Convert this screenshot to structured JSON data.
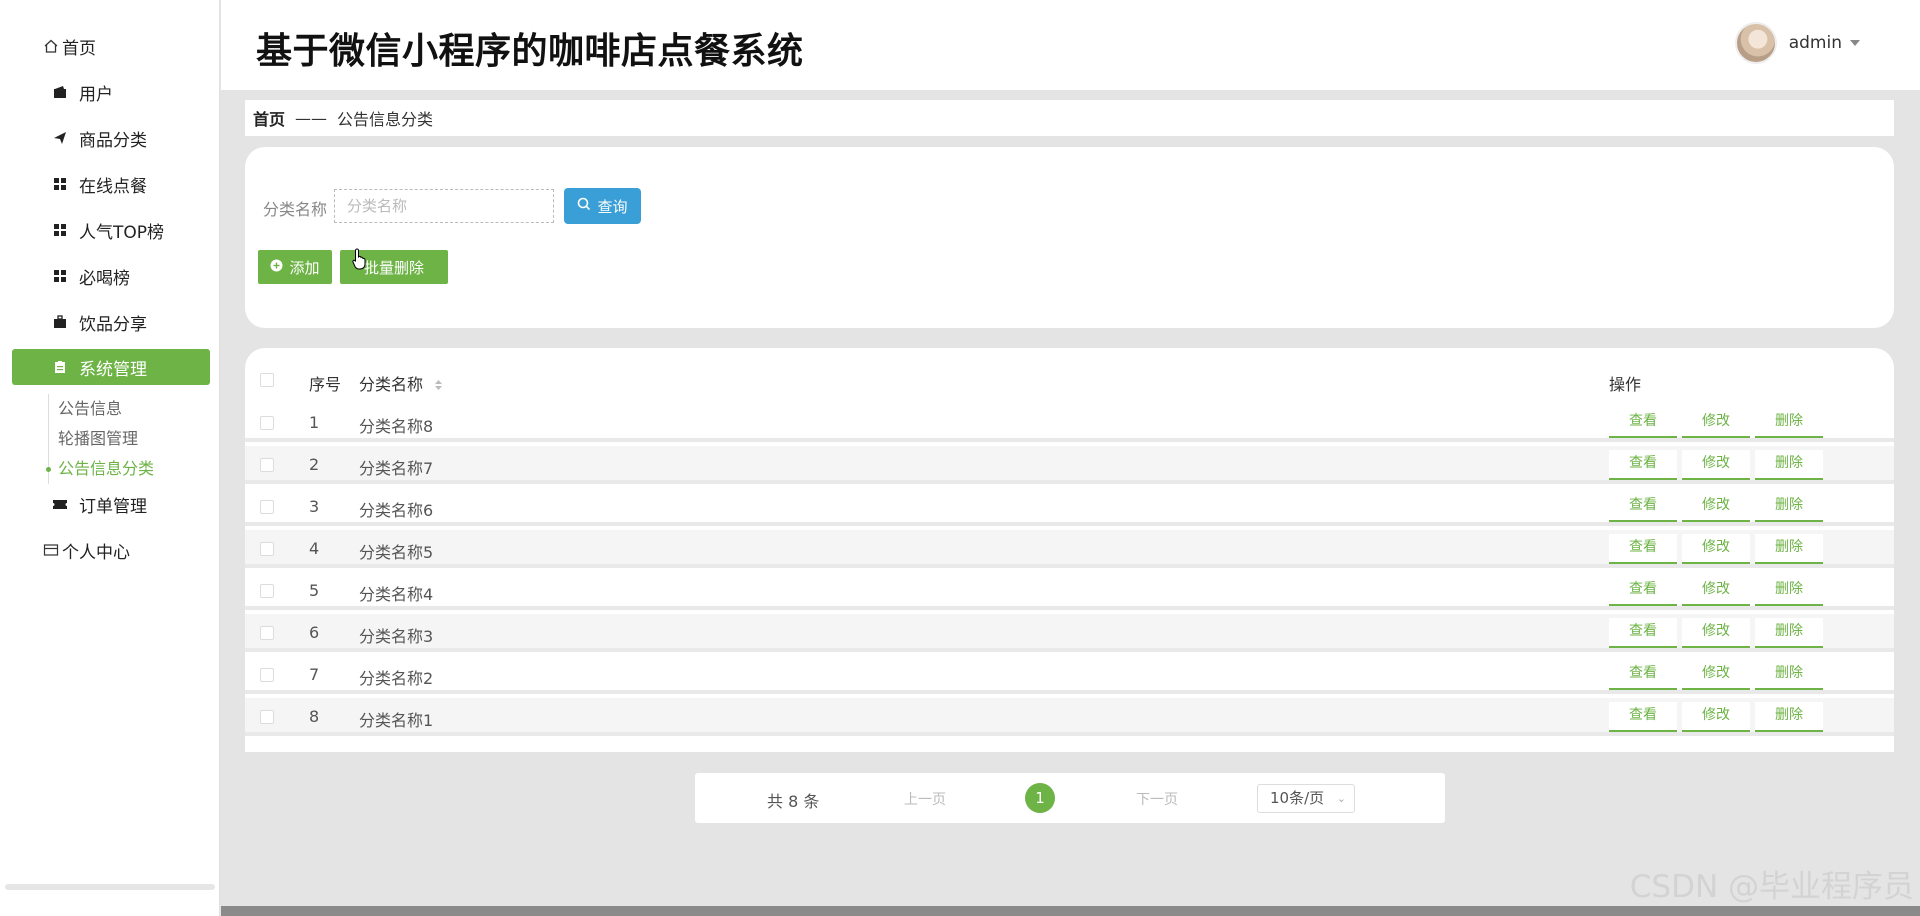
{
  "app": {
    "title": "基于微信小程序的咖啡店点餐系统"
  },
  "user": {
    "name": "admin"
  },
  "sidebar": {
    "items": [
      {
        "label": "首页",
        "icon": "home-icon"
      },
      {
        "label": "用户",
        "icon": "wallet-icon"
      },
      {
        "label": "商品分类",
        "icon": "paper-plane-icon"
      },
      {
        "label": "在线点餐",
        "icon": "grid-icon"
      },
      {
        "label": "人气TOP榜",
        "icon": "grid-icon"
      },
      {
        "label": "必喝榜",
        "icon": "grid-icon"
      },
      {
        "label": "饮品分享",
        "icon": "briefcase-icon"
      },
      {
        "label": "系统管理",
        "icon": "clipboard-icon"
      },
      {
        "label": "订单管理",
        "icon": "ticket-icon"
      },
      {
        "label": "个人中心",
        "icon": "card-icon"
      }
    ],
    "submenu": [
      {
        "label": "公告信息"
      },
      {
        "label": "轮播图管理"
      },
      {
        "label": "公告信息分类"
      }
    ]
  },
  "breadcrumb": {
    "home": "首页",
    "separator": "——",
    "current": "公告信息分类"
  },
  "search": {
    "label": "分类名称",
    "placeholder": "分类名称",
    "query_label": "查询"
  },
  "actions": {
    "add_label": "添加",
    "batch_delete_label": "批量删除"
  },
  "table": {
    "headers": {
      "index": "序号",
      "name": "分类名称",
      "ops": "操作"
    },
    "rows": [
      {
        "index": "1",
        "name": "分类名称8"
      },
      {
        "index": "2",
        "name": "分类名称7"
      },
      {
        "index": "3",
        "name": "分类名称6"
      },
      {
        "index": "4",
        "name": "分类名称5"
      },
      {
        "index": "5",
        "name": "分类名称4"
      },
      {
        "index": "6",
        "name": "分类名称3"
      },
      {
        "index": "7",
        "name": "分类名称2"
      },
      {
        "index": "8",
        "name": "分类名称1"
      }
    ],
    "op_labels": {
      "view": "查看",
      "edit": "修改",
      "delete": "删除"
    }
  },
  "pagination": {
    "total": "共 8 条",
    "prev": "上一页",
    "current": "1",
    "next": "下一页",
    "page_size": "10条/页"
  },
  "watermark": "CSDN @毕业程序员",
  "colors": {
    "accent": "#6db345",
    "query": "#3a9fd6"
  }
}
